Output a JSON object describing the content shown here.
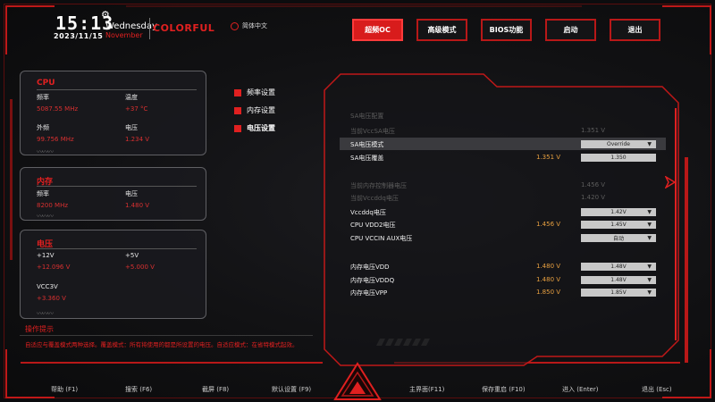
{
  "header": {
    "time": "15:13",
    "date": "2023/11/15",
    "day": "Wednesday",
    "month": "November",
    "brand": "COLORFUL",
    "language": "简体中文"
  },
  "nav": [
    {
      "label": "超频OC",
      "active": true
    },
    {
      "label": "高级模式",
      "active": false
    },
    {
      "label": "BIOS功能",
      "active": false
    },
    {
      "label": "启动",
      "active": false
    },
    {
      "label": "退出",
      "active": false
    }
  ],
  "cpu": {
    "title": "CPU",
    "freq_label": "频率",
    "freq_value": "5087.55 MHz",
    "temp_label": "温度",
    "temp_value": "+37 °C",
    "ext_label": "外频",
    "ext_value": "99.756 MHz",
    "volt_label": "电压",
    "volt_value": "1.234 V"
  },
  "memory": {
    "title": "内存",
    "freq_label": "频率",
    "freq_value": "8200 MHz",
    "volt_label": "电压",
    "volt_value": "1.480 V"
  },
  "voltage": {
    "title": "电压",
    "v12_label": "+12V",
    "v12_value": "+12.096 V",
    "v5_label": "+5V",
    "v5_value": "+5.000 V",
    "vcc3_label": "VCC3V",
    "vcc3_value": "+3.360 V"
  },
  "tips": {
    "title": "操作提示",
    "text": "自适应与覆盖模式两种选择。覆盖模式：所有将使用的都是所设置的电压。自适应模式：在省特模式起效。"
  },
  "menu": [
    {
      "label": "频率设置"
    },
    {
      "label": "内存设置"
    },
    {
      "label": "电压设置"
    }
  ],
  "settings": {
    "section_title": "SA电压配置",
    "current_sa_label": "当前VccSA电压",
    "current_sa_value": "1.351 V",
    "sa_mode_label": "SA电压模式",
    "sa_mode_value": "Override",
    "sa_override_label": "SA电压覆盖",
    "sa_override_current": "1.351 V",
    "sa_override_value": "1.350",
    "current_mc_label": "当前内存控制器电压",
    "current_mc_value": "1.456 V",
    "current_vccddq_label": "当前Vccddq电压",
    "current_vccddq_value": "1.420 V",
    "vccddq_label": "Vccddq电压",
    "vccddq_value": "1.42V",
    "vdd2_label": "CPU VDD2电压",
    "vdd2_current": "1.456 V",
    "vdd2_value": "1.45V",
    "vccin_aux_label": "CPU VCCIN AUX电压",
    "vccin_aux_value": "自动",
    "mem_vdd_label": "内存电压VDD",
    "mem_vdd_current": "1.480 V",
    "mem_vdd_value": "1.48V",
    "mem_vddq_label": "内存电压VDDQ",
    "mem_vddq_current": "1.480 V",
    "mem_vddq_value": "1.48V",
    "mem_vpp_label": "内存电压VPP",
    "mem_vpp_current": "1.850 V",
    "mem_vpp_value": "1.85V"
  },
  "footer": [
    {
      "label": "帮助 (F1)"
    },
    {
      "label": "搜索 (F6)"
    },
    {
      "label": "截屏 (F8)"
    },
    {
      "label": "默认设置 (F9)"
    },
    {
      "label": "主界面(F11)"
    },
    {
      "label": "保存重启 (F10)"
    },
    {
      "label": "进入 (Enter)"
    },
    {
      "label": "退出 (Esc)"
    }
  ],
  "colors": {
    "accent": "#e02020",
    "value_orange": "#e8a040",
    "background": "#111113"
  }
}
